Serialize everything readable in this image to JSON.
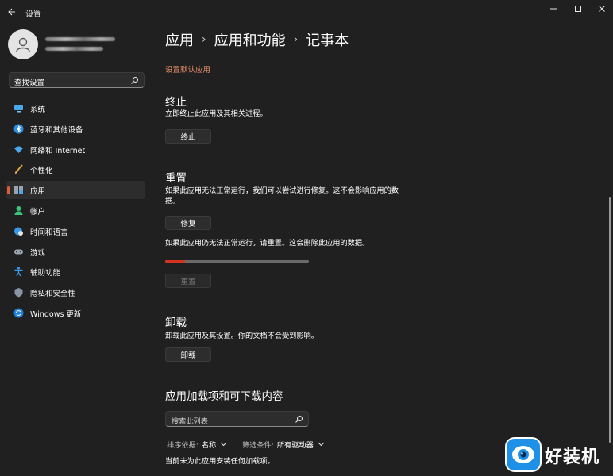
{
  "window": {
    "title": "设置"
  },
  "profile": {
    "email_blurred": "1461****@qq.com",
    "email2_blurred": "H0****@qq.com"
  },
  "sidebar": {
    "search_placeholder": "查找设置",
    "items": [
      {
        "label": "系统",
        "icon": "monitor-icon"
      },
      {
        "label": "蓝牙和其他设备",
        "icon": "bluetooth-icon"
      },
      {
        "label": "网络和 Internet",
        "icon": "wifi-icon"
      },
      {
        "label": "个性化",
        "icon": "brush-icon"
      },
      {
        "label": "应用",
        "icon": "apps-icon",
        "active": true
      },
      {
        "label": "帐户",
        "icon": "person-icon"
      },
      {
        "label": "时间和语言",
        "icon": "globe-clock-icon"
      },
      {
        "label": "游戏",
        "icon": "gamepad-icon"
      },
      {
        "label": "辅助功能",
        "icon": "accessibility-icon"
      },
      {
        "label": "隐私和安全性",
        "icon": "shield-icon"
      },
      {
        "label": "Windows 更新",
        "icon": "update-icon"
      }
    ]
  },
  "breadcrumb": [
    "应用",
    "应用和功能",
    "记事本"
  ],
  "main": {
    "default_apps_link": "设置默认应用",
    "terminate": {
      "heading": "终止",
      "desc": "立即终止此应用及其相关进程。",
      "button": "终止"
    },
    "reset": {
      "heading": "重置",
      "repair_desc_line1": "如果此应用无法正常运行，我们可以尝试进行修复。这不会影响应用的数",
      "repair_desc_line2": "据。",
      "repair_button": "修复",
      "reset_desc": "如果此应用仍无法正常运行，请重置。这会删除此应用的数据。",
      "progress": 0.14,
      "reset_button": "重置"
    },
    "uninstall": {
      "heading": "卸载",
      "desc": "卸载此应用及其设置。你的文档不会受到影响。",
      "button": "卸载"
    },
    "addons": {
      "heading": "应用加载项和可下载内容",
      "search_placeholder": "搜索此列表",
      "sort_label": "排序依据:",
      "sort_value": "名称",
      "filter_label": "筛选条件:",
      "filter_value": "所有驱动器",
      "empty_text": "当前未为此应用安装任何加载项。"
    }
  },
  "watermark": {
    "text": "好装机"
  },
  "colors": {
    "accent": "#d95b3c",
    "link": "#e08a66",
    "progress": "#d4341e",
    "background": "#202020"
  }
}
